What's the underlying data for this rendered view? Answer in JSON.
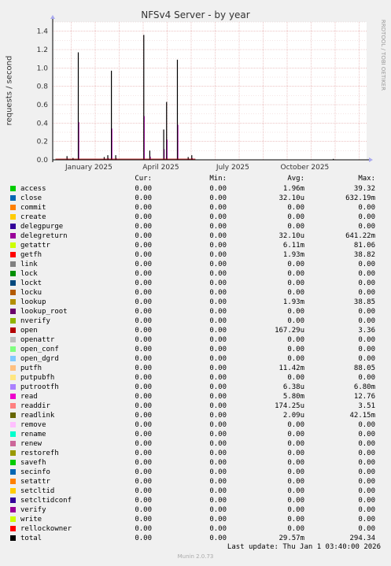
{
  "chart_data": {
    "type": "line",
    "title": "NFSv4 Server - by year",
    "ylabel": "requests / second",
    "side_label": "RRDTOOL / TOBI OETIKER",
    "ylim": [
      0,
      1.5
    ],
    "yticks": [
      "0.0",
      "0.2",
      "0.4",
      "0.6",
      "0.8",
      "1.0",
      "1.2",
      "1.4"
    ],
    "xticks": [
      "January 2025",
      "April 2025",
      "July 2025",
      "October 2025"
    ],
    "spikes": [
      {
        "month": 0.35,
        "value": 0.04
      },
      {
        "month": 0.6,
        "value": 0.02
      },
      {
        "month": 0.82,
        "value": 1.17
      },
      {
        "month": 1.9,
        "value": 0.03
      },
      {
        "month": 2.05,
        "value": 0.05
      },
      {
        "month": 2.2,
        "value": 0.97
      },
      {
        "month": 2.38,
        "value": 0.05
      },
      {
        "month": 3.55,
        "value": 1.36
      },
      {
        "month": 3.8,
        "value": 0.1
      },
      {
        "month": 4.38,
        "value": 0.33
      },
      {
        "month": 4.5,
        "value": 0.63
      },
      {
        "month": 4.95,
        "value": 1.09
      },
      {
        "month": 5.4,
        "value": 0.03
      },
      {
        "month": 5.55,
        "value": 0.05
      },
      {
        "month": 11.45,
        "value": 0.01
      }
    ]
  },
  "legend_headers": {
    "cur": "Cur:",
    "min": "Min:",
    "avg": "Avg:",
    "max": "Max:"
  },
  "legend": [
    {
      "name": "access",
      "color": "#00cc00",
      "cur": "0.00",
      "min": "0.00",
      "avg": "1.96m",
      "max": "39.32"
    },
    {
      "name": "close",
      "color": "#0066b3",
      "cur": "0.00",
      "min": "0.00",
      "avg": "32.10u",
      "max": "632.19m"
    },
    {
      "name": "commit",
      "color": "#ff8000",
      "cur": "0.00",
      "min": "0.00",
      "avg": "0.00",
      "max": "0.00"
    },
    {
      "name": "create",
      "color": "#ffcc00",
      "cur": "0.00",
      "min": "0.00",
      "avg": "0.00",
      "max": "0.00"
    },
    {
      "name": "delegpurge",
      "color": "#330099",
      "cur": "0.00",
      "min": "0.00",
      "avg": "0.00",
      "max": "0.00"
    },
    {
      "name": "delegreturn",
      "color": "#990099",
      "cur": "0.00",
      "min": "0.00",
      "avg": "32.10u",
      "max": "641.22m"
    },
    {
      "name": "getattr",
      "color": "#ccff00",
      "cur": "0.00",
      "min": "0.00",
      "avg": "6.11m",
      "max": "81.06"
    },
    {
      "name": "getfh",
      "color": "#ff0000",
      "cur": "0.00",
      "min": "0.00",
      "avg": "1.93m",
      "max": "38.82"
    },
    {
      "name": "link",
      "color": "#808080",
      "cur": "0.00",
      "min": "0.00",
      "avg": "0.00",
      "max": "0.00"
    },
    {
      "name": "lock",
      "color": "#008f00",
      "cur": "0.00",
      "min": "0.00",
      "avg": "0.00",
      "max": "0.00"
    },
    {
      "name": "lockt",
      "color": "#00487d",
      "cur": "0.00",
      "min": "0.00",
      "avg": "0.00",
      "max": "0.00"
    },
    {
      "name": "locku",
      "color": "#b35a00",
      "cur": "0.00",
      "min": "0.00",
      "avg": "0.00",
      "max": "0.00"
    },
    {
      "name": "lookup",
      "color": "#b38f00",
      "cur": "0.00",
      "min": "0.00",
      "avg": "1.93m",
      "max": "38.85"
    },
    {
      "name": "lookup_root",
      "color": "#6b006b",
      "cur": "0.00",
      "min": "0.00",
      "avg": "0.00",
      "max": "0.00"
    },
    {
      "name": "nverify",
      "color": "#8fb300",
      "cur": "0.00",
      "min": "0.00",
      "avg": "0.00",
      "max": "0.00"
    },
    {
      "name": "open",
      "color": "#b30000",
      "cur": "0.00",
      "min": "0.00",
      "avg": "167.29u",
      "max": "3.36"
    },
    {
      "name": "openattr",
      "color": "#bebebe",
      "cur": "0.00",
      "min": "0.00",
      "avg": "0.00",
      "max": "0.00"
    },
    {
      "name": "open_conf",
      "color": "#80ff80",
      "cur": "0.00",
      "min": "0.00",
      "avg": "0.00",
      "max": "0.00"
    },
    {
      "name": "open_dgrd",
      "color": "#80c9ff",
      "cur": "0.00",
      "min": "0.00",
      "avg": "0.00",
      "max": "0.00"
    },
    {
      "name": "putfh",
      "color": "#ffc080",
      "cur": "0.00",
      "min": "0.00",
      "avg": "11.42m",
      "max": "88.05"
    },
    {
      "name": "putpubfh",
      "color": "#ffe680",
      "cur": "0.00",
      "min": "0.00",
      "avg": "0.00",
      "max": "0.00"
    },
    {
      "name": "putrootfh",
      "color": "#aa80ff",
      "cur": "0.00",
      "min": "0.00",
      "avg": "6.38u",
      "max": "6.80m"
    },
    {
      "name": "read",
      "color": "#ee00cc",
      "cur": "0.00",
      "min": "0.00",
      "avg": "5.80m",
      "max": "12.76"
    },
    {
      "name": "readdir",
      "color": "#ff8080",
      "cur": "0.00",
      "min": "0.00",
      "avg": "174.25u",
      "max": "3.51"
    },
    {
      "name": "readlink",
      "color": "#666600",
      "cur": "0.00",
      "min": "0.00",
      "avg": "2.09u",
      "max": "42.15m"
    },
    {
      "name": "remove",
      "color": "#ffbfff",
      "cur": "0.00",
      "min": "0.00",
      "avg": "0.00",
      "max": "0.00"
    },
    {
      "name": "rename",
      "color": "#00ffcc",
      "cur": "0.00",
      "min": "0.00",
      "avg": "0.00",
      "max": "0.00"
    },
    {
      "name": "renew",
      "color": "#cc6699",
      "cur": "0.00",
      "min": "0.00",
      "avg": "0.00",
      "max": "0.00"
    },
    {
      "name": "restorefh",
      "color": "#999900",
      "cur": "0.00",
      "min": "0.00",
      "avg": "0.00",
      "max": "0.00"
    },
    {
      "name": "savefh",
      "color": "#00cc00",
      "cur": "0.00",
      "min": "0.00",
      "avg": "0.00",
      "max": "0.00"
    },
    {
      "name": "secinfo",
      "color": "#0066b3",
      "cur": "0.00",
      "min": "0.00",
      "avg": "0.00",
      "max": "0.00"
    },
    {
      "name": "setattr",
      "color": "#ff8000",
      "cur": "0.00",
      "min": "0.00",
      "avg": "0.00",
      "max": "0.00"
    },
    {
      "name": "setcltid",
      "color": "#ffcc00",
      "cur": "0.00",
      "min": "0.00",
      "avg": "0.00",
      "max": "0.00"
    },
    {
      "name": "setcltidconf",
      "color": "#330099",
      "cur": "0.00",
      "min": "0.00",
      "avg": "0.00",
      "max": "0.00"
    },
    {
      "name": "verify",
      "color": "#990099",
      "cur": "0.00",
      "min": "0.00",
      "avg": "0.00",
      "max": "0.00"
    },
    {
      "name": "write",
      "color": "#ccff00",
      "cur": "0.00",
      "min": "0.00",
      "avg": "0.00",
      "max": "0.00"
    },
    {
      "name": "rellockowner",
      "color": "#ff0000",
      "cur": "0.00",
      "min": "0.00",
      "avg": "0.00",
      "max": "0.00"
    },
    {
      "name": "total",
      "color": "#000000",
      "cur": "0.00",
      "min": "0.00",
      "avg": "29.57m",
      "max": "294.34"
    }
  ],
  "last_update": "Last update: Thu Jan  1 03:40:00 2026",
  "munin_version": "Munin 2.0.73"
}
